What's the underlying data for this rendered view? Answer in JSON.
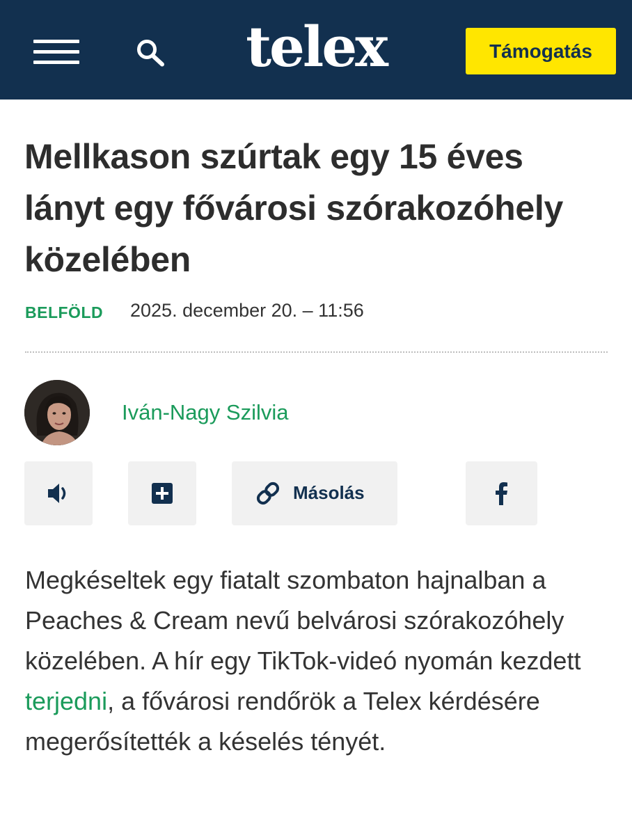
{
  "header": {
    "logo": "telex",
    "support_label": "Támogatás",
    "menu_icon": "hamburger-menu-icon",
    "search_icon": "search-icon",
    "bg_color": "#12304f",
    "support_color": "#ffe600"
  },
  "article": {
    "title": "Mellkason szúrtak egy 15 éves lányt egy fővárosi szórakozóhely közelében",
    "category": "BELFÖLD",
    "date": "2025. december 20. – 11:56",
    "author": "Iván-Nagy Szilvia",
    "accent_color": "#1b9b5b",
    "actions": {
      "audio_icon": "speaker-icon",
      "add_icon": "plus-square-icon",
      "copy_icon": "link-icon",
      "copy_label": "Másolás",
      "facebook_icon": "facebook-icon"
    },
    "lead": {
      "before_link": "Megkéseltek egy fiatalt szombaton hajnalban a Peaches & Cream nevű belvárosi szórakozóhely közelében. A hír egy TikTok-videó nyomán kezdett ",
      "link": "terjedni",
      "after_link": ", a fővárosi rendőrök a Telex kérdésére megerősítették a késelés tényét."
    }
  }
}
